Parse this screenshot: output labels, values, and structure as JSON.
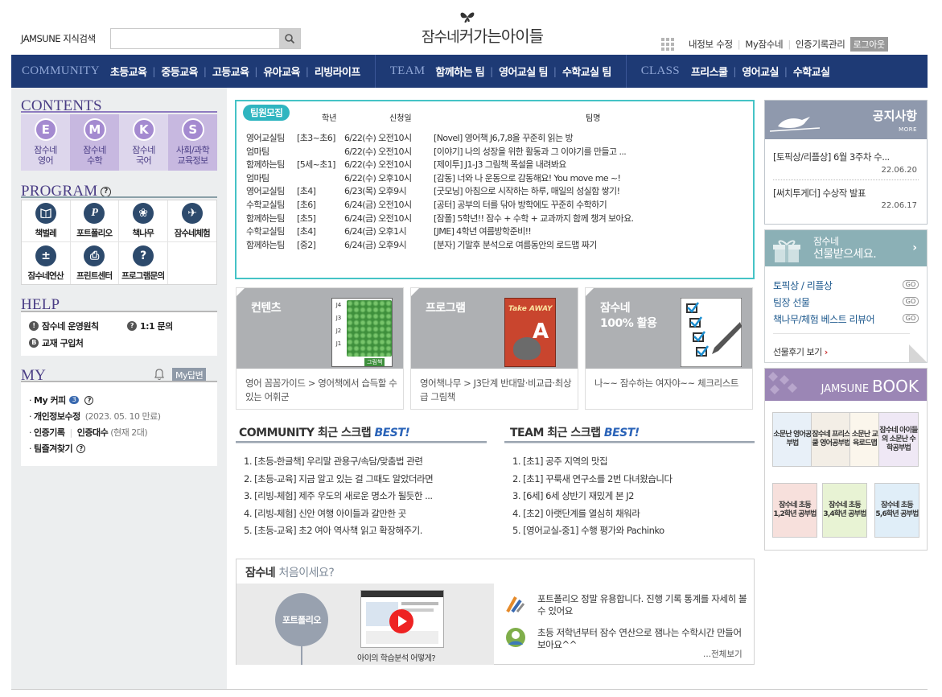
{
  "header": {
    "search_label": "JAMSUNE 지식검색",
    "search_value": "",
    "logo_main": "잠수네",
    "logo_sub": "커가는아이들",
    "util": [
      "내정보 수정",
      "My잠수네",
      "인증기록관리"
    ],
    "logout": "로그아웃"
  },
  "nav": {
    "community_label": "COMMUNITY",
    "community_items": [
      "초등교육",
      "중등교육",
      "고등교육",
      "유아교육",
      "리빙라이프"
    ],
    "team_label": "TEAM",
    "team_items": [
      "함께하는 팀",
      "영어교실 팀",
      "수학교실 팀"
    ],
    "class_label": "CLASS",
    "class_items": [
      "프리스쿨",
      "영어교실",
      "수학교실"
    ]
  },
  "contents": {
    "title": "CONTENTS",
    "items": [
      {
        "letter": "E",
        "line1": "잠수네",
        "line2": "영어"
      },
      {
        "letter": "M",
        "line1": "잠수네",
        "line2": "수학"
      },
      {
        "letter": "K",
        "line1": "잠수네",
        "line2": "국어"
      },
      {
        "letter": "S",
        "line1": "사회/과학",
        "line2": "교육정보"
      }
    ]
  },
  "program": {
    "title": "PROGRAM",
    "items": [
      "책벌레",
      "포트폴리오",
      "책나무",
      "잠수네체험",
      "잠수네연산",
      "프린트센터",
      "프로그램문의"
    ]
  },
  "help": {
    "title": "HELP",
    "items": [
      "잠수네 운영원칙",
      "1:1 문의",
      "교재 구입처"
    ]
  },
  "my": {
    "title": "MY",
    "reply": "My답변",
    "cafe": "My 커피",
    "cafe_badge": "3",
    "privacy": "개인정보수정",
    "privacy_date": "(2023. 05. 10 만료)",
    "cert": "인증기록",
    "cert_count_label": "인증대수",
    "cert_count": "(현재 2대)",
    "bookmark": "팀즐겨찾기"
  },
  "recruit": {
    "tag": "팀원모집",
    "headers": [
      "학년",
      "신청일",
      "팀명"
    ],
    "rows": [
      {
        "team": "영어교실팀",
        "grade": "[초3~초6]",
        "date": "6/22(수) 오전10시",
        "name": "[Novel] 영어책 J6,7,8을 꾸준히 읽는 방"
      },
      {
        "team": "엄마팀",
        "grade": "",
        "date": "6/22(수) 오전10시",
        "name": "[이야기] 나의 성장을 위한 활동과 그 이야기를 만들고 ..."
      },
      {
        "team": "함께하는팀",
        "grade": "[5세~초1]",
        "date": "6/22(수) 오전10시",
        "name": "[제이투] J1-J3 그림책 폭설을 내려봐요"
      },
      {
        "team": "엄마팀",
        "grade": "",
        "date": "6/22(수) 오후10시",
        "name": "[감동] 너와 나 운동으로 감동해요! You move me ~!"
      },
      {
        "team": "영어교실팀",
        "grade": "[초4]",
        "date": "6/23(목) 오후9시",
        "name": "[굿모닝] 아침으로 시작하는 하루, 매일의 성실함 쌓기!"
      },
      {
        "team": "수학교실팀",
        "grade": "[초6]",
        "date": "6/24(금) 오전10시",
        "name": "[공터] 공부의 터를 닦아 방학에도 꾸준히 수학하기"
      },
      {
        "team": "함께하는팀",
        "grade": "[초5]",
        "date": "6/24(금) 오전10시",
        "name": "[잠폴] 5학년!! 잠수 + 수학 + 교과까지 함께 챙겨 보아요."
      },
      {
        "team": "수학교실팀",
        "grade": "[초4]",
        "date": "6/24(금) 오후1시",
        "name": "[JME] 4학년 여름방학준비!!"
      },
      {
        "team": "함께하는팀",
        "grade": "[중2]",
        "date": "6/24(금) 오후9시",
        "name": "[분자] 기말후 분석으로 여름동안의 로드맵 짜기"
      }
    ]
  },
  "promo": [
    {
      "title": "컨텐츠",
      "subtitle": "",
      "desc": "영어 꼼꼼가이드 > 영어책에서 습득할 수 있는 어휘군",
      "art_labels": [
        "J4",
        "J3",
        "J2",
        "J1",
        "그림책"
      ]
    },
    {
      "title": "프로그램",
      "subtitle": "",
      "desc": "영어책나무 > J3단계 반대말·비교급·최상급 그림책",
      "art_labels": [
        "Take AWAY",
        "A"
      ]
    },
    {
      "title": "잠수네",
      "subtitle": "100% 활용",
      "desc": "나~~ 잠수하는 여자야~~ 체크리스트",
      "art_labels": []
    }
  ],
  "scrap_community": {
    "title": "COMMUNITY 최근 스크랩",
    "best": "BEST!",
    "items": [
      "1. [초등-한글책] 우리말 관용구/속담/맞춤법 관련",
      "2. [초등-교육] 지금 알고 있는 걸 그때도 알았더라면",
      "3. [리빙-체험] 제주 우도의 새로운 명소가 될듯한 ...",
      "4. [리빙-체험] 신안 여행 아이들과 갈만한 곳",
      "5. [초등-교육] 초2 여아 역사책 읽고 확장해주기."
    ]
  },
  "scrap_team": {
    "title": "TEAM 최근 스크랩",
    "best": "BEST!",
    "items": [
      "1. [초1] 공주 지역의 맛집",
      "2. [초1] 꾸룩새 연구소를 2번 다녀왔습니다",
      "3. [6세] 6세 상반기 재밌게 본 J2",
      "4. [초2] 아랫단계를 열심히 채워라",
      "5. [영어교실-중1] 수행 평가와 Pachinko"
    ]
  },
  "intro": {
    "title_main": "잠수네",
    "title_sub": "처음이세요?",
    "circle": "포트폴리오",
    "caption": "아이의 학습분석 어떻게?",
    "testimonials": [
      "포트폴리오 정말 유용합니다. 진행 기록 통계를 자세히 볼수 있어요",
      "초등 저학년부터 잠수 연산으로 잼나는 수학시간 만들어보아요^^"
    ],
    "more": "...전체보기"
  },
  "notice": {
    "title": "공지사항",
    "more": "MORE",
    "items": [
      {
        "text": "[토픽상/리플상] 6월 3주차 수...",
        "date": "22.06.20"
      },
      {
        "text": "[써치투게더] 수상작 발표",
        "date": "22.06.17"
      }
    ]
  },
  "gift": {
    "title_top": "잠수네",
    "title_main": "선물받으세요.",
    "items": [
      "토픽상 / 리플상",
      "팀장 선물",
      "책나무/체험 베스트 리뷰어"
    ],
    "go": "GO",
    "review": "선물후기 보기"
  },
  "book": {
    "brand": "JAMSUNE",
    "title": "BOOK",
    "covers": [
      {
        "text": "소문난 영어공부법",
        "color": "#e8f0f8"
      },
      {
        "text": "잠수네 프리스쿨 영어공부법",
        "color": "#f3eee6"
      },
      {
        "text": "소문난 교육로드맵",
        "color": "#fbf6ec"
      },
      {
        "text": "잠수네 아이들의 소문난 수학공부법",
        "color": "#efe8f5"
      },
      {
        "text": "잠수네 초등 1,2학년 공부법",
        "color": "#f7e0dc"
      },
      {
        "text": "잠수네 초등 3,4학년 공부법",
        "color": "#e8f3d4"
      },
      {
        "text": "잠수네 초등 5,6학년 공부법",
        "color": "#e0eef8"
      }
    ]
  }
}
